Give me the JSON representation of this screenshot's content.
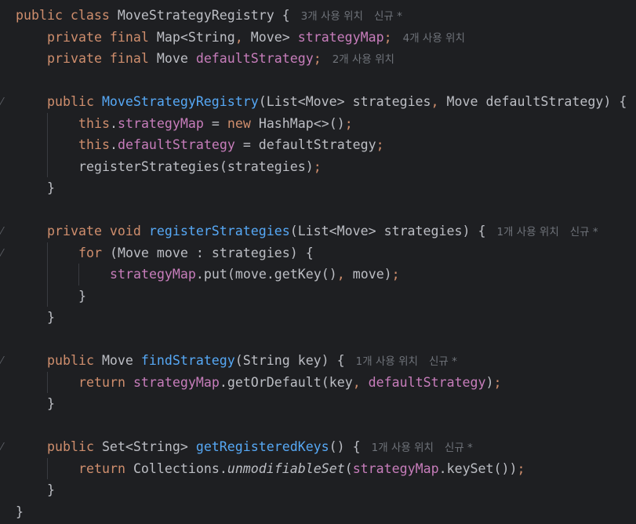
{
  "editor": {
    "hints": {
      "usages_3": "3개 사용 위치",
      "usages_4": "4개 사용 위치",
      "usages_2": "2개 사용 위치",
      "usages_1": "1개 사용 위치",
      "new": "신규 *"
    },
    "colors": {
      "background": "#1e1f22",
      "keyword": "#cf8e6d",
      "field": "#c77dbb",
      "method": "#56a8f5",
      "text": "#bcbec4",
      "hint": "#6f737a"
    },
    "lines": [
      {
        "indent": 0,
        "tokens": [
          {
            "t": "public class ",
            "c": "kw"
          },
          {
            "t": "MoveStrategyRegistry {",
            "c": "plain"
          }
        ],
        "hint": "usages_3",
        "new": true,
        "gutter": false
      },
      {
        "indent": 1,
        "tokens": [
          {
            "t": "private final ",
            "c": "kw"
          },
          {
            "t": "Map<String",
            "c": "plain"
          },
          {
            "t": ", ",
            "c": "kw"
          },
          {
            "t": "Move> ",
            "c": "plain"
          },
          {
            "t": "strategyMap",
            "c": "fld"
          },
          {
            "t": ";",
            "c": "kw"
          }
        ],
        "hint": "usages_4",
        "new": false,
        "gutter": false
      },
      {
        "indent": 1,
        "tokens": [
          {
            "t": "private final ",
            "c": "kw"
          },
          {
            "t": "Move ",
            "c": "plain"
          },
          {
            "t": "defaultStrategy",
            "c": "fld"
          },
          {
            "t": ";",
            "c": "kw"
          }
        ],
        "hint": "usages_2",
        "new": false,
        "gutter": false
      },
      {
        "indent": 0,
        "tokens": [],
        "hint": null,
        "new": false,
        "gutter": false
      },
      {
        "indent": 1,
        "tokens": [
          {
            "t": "public ",
            "c": "kw"
          },
          {
            "t": "MoveStrategyRegistry",
            "c": "fn"
          },
          {
            "t": "(List<Move> strategies",
            "c": "plain"
          },
          {
            "t": ", ",
            "c": "kw"
          },
          {
            "t": "Move defaultStrategy) {",
            "c": "plain"
          }
        ],
        "hint": null,
        "new": false,
        "gutter": true
      },
      {
        "indent": 2,
        "tokens": [
          {
            "t": "this",
            "c": "kw"
          },
          {
            "t": ".",
            "c": "plain"
          },
          {
            "t": "strategyMap",
            "c": "fld"
          },
          {
            "t": " = ",
            "c": "plain"
          },
          {
            "t": "new ",
            "c": "kw"
          },
          {
            "t": "HashMap<>()",
            "c": "plain"
          },
          {
            "t": ";",
            "c": "kw"
          }
        ],
        "hint": null,
        "new": false,
        "gutter": false
      },
      {
        "indent": 2,
        "tokens": [
          {
            "t": "this",
            "c": "kw"
          },
          {
            "t": ".",
            "c": "plain"
          },
          {
            "t": "defaultStrategy",
            "c": "fld"
          },
          {
            "t": " = defaultStrategy",
            "c": "plain"
          },
          {
            "t": ";",
            "c": "kw"
          }
        ],
        "hint": null,
        "new": false,
        "gutter": false
      },
      {
        "indent": 2,
        "tokens": [
          {
            "t": "registerStrategies(strategies)",
            "c": "plain"
          },
          {
            "t": ";",
            "c": "kw"
          }
        ],
        "hint": null,
        "new": false,
        "gutter": false
      },
      {
        "indent": 1,
        "tokens": [
          {
            "t": "}",
            "c": "plain"
          }
        ],
        "hint": null,
        "new": false,
        "gutter": false
      },
      {
        "indent": 0,
        "tokens": [],
        "hint": null,
        "new": false,
        "gutter": false
      },
      {
        "indent": 1,
        "tokens": [
          {
            "t": "private void ",
            "c": "kw"
          },
          {
            "t": "registerStrategies",
            "c": "fn"
          },
          {
            "t": "(List<Move> strategies) {",
            "c": "plain"
          }
        ],
        "hint": "usages_1",
        "new": true,
        "gutter": true
      },
      {
        "indent": 2,
        "tokens": [
          {
            "t": "for ",
            "c": "kw"
          },
          {
            "t": "(Move move : strategies) {",
            "c": "plain"
          }
        ],
        "hint": null,
        "new": false,
        "gutter": true
      },
      {
        "indent": 3,
        "tokens": [
          {
            "t": "strategyMap",
            "c": "fld"
          },
          {
            "t": ".put(move.getKey()",
            "c": "plain"
          },
          {
            "t": ", ",
            "c": "kw"
          },
          {
            "t": "move)",
            "c": "plain"
          },
          {
            "t": ";",
            "c": "kw"
          }
        ],
        "hint": null,
        "new": false,
        "gutter": false
      },
      {
        "indent": 2,
        "tokens": [
          {
            "t": "}",
            "c": "plain"
          }
        ],
        "hint": null,
        "new": false,
        "gutter": false
      },
      {
        "indent": 1,
        "tokens": [
          {
            "t": "}",
            "c": "plain"
          }
        ],
        "hint": null,
        "new": false,
        "gutter": false
      },
      {
        "indent": 0,
        "tokens": [],
        "hint": null,
        "new": false,
        "gutter": false
      },
      {
        "indent": 1,
        "tokens": [
          {
            "t": "public ",
            "c": "kw"
          },
          {
            "t": "Move ",
            "c": "plain"
          },
          {
            "t": "findStrategy",
            "c": "fn"
          },
          {
            "t": "(String key) {",
            "c": "plain"
          }
        ],
        "hint": "usages_1",
        "new": true,
        "gutter": true
      },
      {
        "indent": 2,
        "tokens": [
          {
            "t": "return ",
            "c": "kw"
          },
          {
            "t": "strategyMap",
            "c": "fld"
          },
          {
            "t": ".getOrDefault(key",
            "c": "plain"
          },
          {
            "t": ", ",
            "c": "kw"
          },
          {
            "t": "defaultStrategy",
            "c": "fld"
          },
          {
            "t": ")",
            "c": "plain"
          },
          {
            "t": ";",
            "c": "kw"
          }
        ],
        "hint": null,
        "new": false,
        "gutter": false
      },
      {
        "indent": 1,
        "tokens": [
          {
            "t": "}",
            "c": "plain"
          }
        ],
        "hint": null,
        "new": false,
        "gutter": false
      },
      {
        "indent": 0,
        "tokens": [],
        "hint": null,
        "new": false,
        "gutter": false
      },
      {
        "indent": 1,
        "tokens": [
          {
            "t": "public ",
            "c": "kw"
          },
          {
            "t": "Set<String> ",
            "c": "plain"
          },
          {
            "t": "getRegisteredKeys",
            "c": "fn"
          },
          {
            "t": "() {",
            "c": "plain"
          }
        ],
        "hint": "usages_1",
        "new": true,
        "gutter": true
      },
      {
        "indent": 2,
        "tokens": [
          {
            "t": "return ",
            "c": "kw"
          },
          {
            "t": "Collections.",
            "c": "plain"
          },
          {
            "t": "unmodifiableSet",
            "c": "it"
          },
          {
            "t": "(",
            "c": "plain"
          },
          {
            "t": "strategyMap",
            "c": "fld"
          },
          {
            "t": ".keySet())",
            "c": "plain"
          },
          {
            "t": ";",
            "c": "kw"
          }
        ],
        "hint": null,
        "new": false,
        "gutter": false
      },
      {
        "indent": 1,
        "tokens": [
          {
            "t": "}",
            "c": "plain"
          }
        ],
        "hint": null,
        "new": false,
        "gutter": false
      },
      {
        "indent": 0,
        "tokens": [
          {
            "t": "}",
            "c": "plain"
          }
        ],
        "hint": null,
        "new": false,
        "gutter": false
      }
    ]
  }
}
